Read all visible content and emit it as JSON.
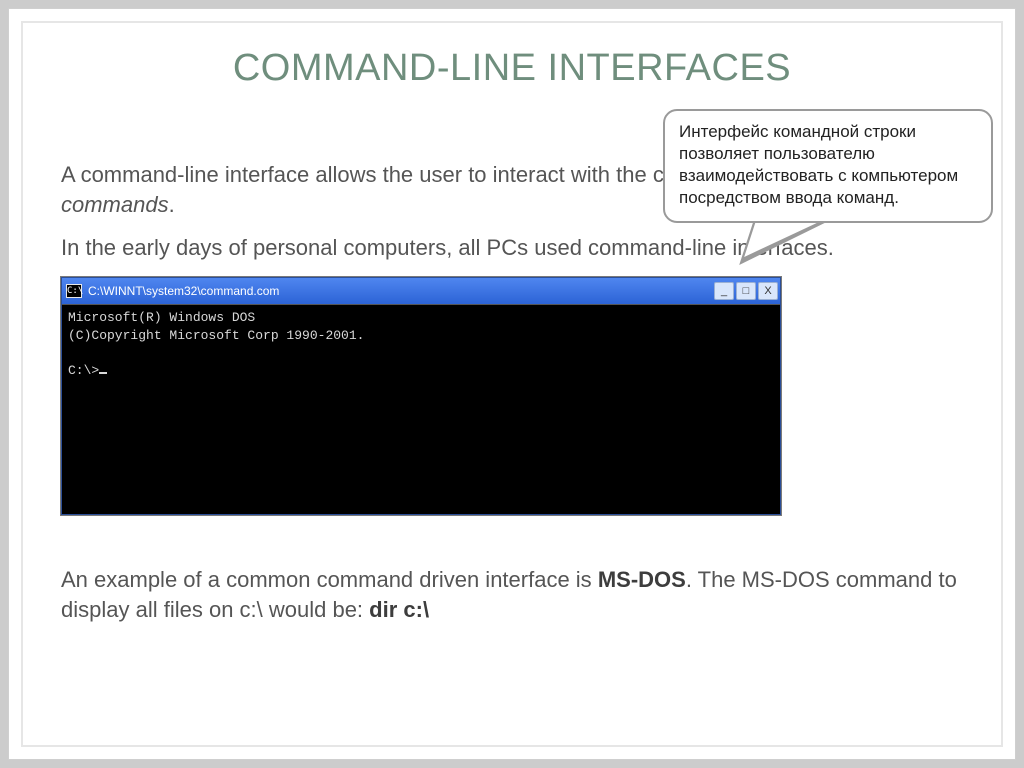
{
  "title": "COMMAND-LINE INTERFACES",
  "paragraphs": {
    "p1_a": "A command-line interface allows the user to interact with the computer by typing in ",
    "p1_b": "commands",
    "p1_c": ".",
    "p2": "In the early days of personal computers, all PCs used command-line interfaces."
  },
  "callout": "Интерфейс командной строки позволяет пользователю взаимодействовать с компьютером посредством ввода команд.",
  "dos": {
    "icon_label": "C:\\",
    "title": "C:\\WINNT\\system32\\command.com",
    "line1": "Microsoft(R) Windows DOS",
    "line2": "(C)Copyright Microsoft Corp 1990-2001.",
    "prompt": "C:\\>"
  },
  "controls": {
    "min": "_",
    "max": "□",
    "close": "X"
  },
  "example": {
    "a": "An example of a common command driven interface is ",
    "b": "MS-DOS",
    "c": ". The MS-DOS command to display all files on c:\\ would be: ",
    "d": "dir c:\\"
  }
}
